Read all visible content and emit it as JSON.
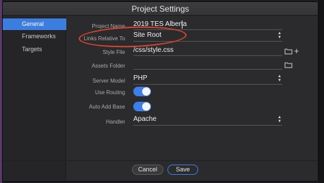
{
  "window": {
    "title": "Project Settings"
  },
  "sidebar": {
    "items": [
      {
        "label": "General",
        "active": true
      },
      {
        "label": "Frameworks",
        "active": false
      },
      {
        "label": "Targets",
        "active": false
      }
    ]
  },
  "form": {
    "project_name": {
      "label": "Project Name",
      "value": "2019 TES Alberta"
    },
    "links_relative_to": {
      "label": "Links Relative To",
      "value": "Site Root"
    },
    "style_file": {
      "label": "Style File",
      "value": "/css/style.css"
    },
    "assets_folder": {
      "label": "Assets Folder",
      "value": ""
    },
    "server_model": {
      "label": "Server Model",
      "value": "PHP"
    },
    "use_routing": {
      "label": "Use Routing",
      "on": true
    },
    "auto_add_base": {
      "label": "Auto Add Base",
      "on": true
    },
    "handler": {
      "label": "Handler",
      "value": "Apache"
    }
  },
  "footer": {
    "cancel_label": "Cancel",
    "save_label": "Save"
  },
  "colors": {
    "accent": "#3d7ee8",
    "annotation": "#d6452e",
    "background": "#2b2b2d"
  },
  "icons": [
    "folder-icon",
    "plus-icon",
    "select-arrows-icon"
  ]
}
